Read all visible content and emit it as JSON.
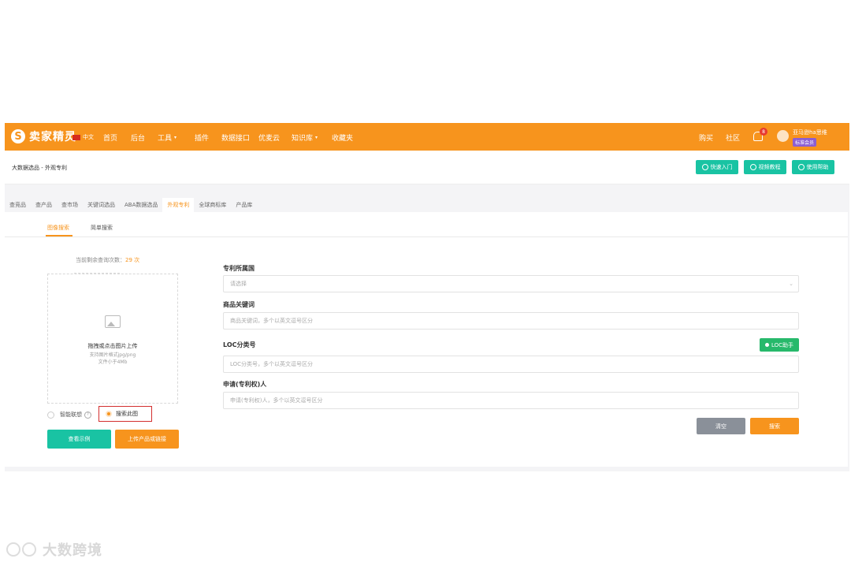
{
  "topbar": {
    "brand": "卖家精灵",
    "brand_icon": "S",
    "language": "中文",
    "nav": [
      "首页",
      "后台",
      "工具",
      "插件",
      "数据接口",
      "优麦云",
      "知识库",
      "收藏夹"
    ],
    "right": [
      "购买",
      "社区"
    ],
    "notifications": "8",
    "username": "亚马逊ha思维",
    "plan": "标准会员",
    "accent": "#f7941d"
  },
  "breadcrumb": "大数据选品 - 外观专利",
  "top_buttons": [
    "快速入门",
    "视频教程",
    "使用帮助"
  ],
  "tabs": [
    "查竞品",
    "查产品",
    "查市场",
    "关键词选品",
    "ABA数据选品",
    "外观专利",
    "全球商标库",
    "产品库"
  ],
  "active_tab": "外观专利",
  "subtabs": [
    "图像搜索",
    "简单搜索"
  ],
  "quota": {
    "label": "当前剩余查询次数：",
    "value": "29 次"
  },
  "upload": {
    "title": "拖拽或点击图片上传",
    "hint1": "支持图片格式jpg/png",
    "hint2": "文件小于4Mb"
  },
  "options": {
    "smart": "智能联想",
    "search_image": "搜索此图"
  },
  "buttons": {
    "example": "查看示例",
    "upload_link": "上传产品或链接",
    "clear": "清空",
    "search": "搜索",
    "loc": "LOC助手"
  },
  "form": {
    "region_label": "专利所属国",
    "region_placeholder": "请选择",
    "keyword_label": "商品关键词",
    "keyword_placeholder": "商品关键词，多个以英文逗号区分",
    "loc_label": "LOC分类号",
    "loc_placeholder": "LOC分类号，多个以英文逗号区分",
    "applicant_label": "申请(专利权)人",
    "applicant_placeholder": "申请(专利权)人，多个以英文逗号区分"
  },
  "watermark": "大数跨境",
  "colors": {
    "orange": "#f7941d",
    "teal": "#19c3a3",
    "green": "#27b96b",
    "gray_btn": "#8a9099",
    "red_box": "#d32f2f"
  }
}
